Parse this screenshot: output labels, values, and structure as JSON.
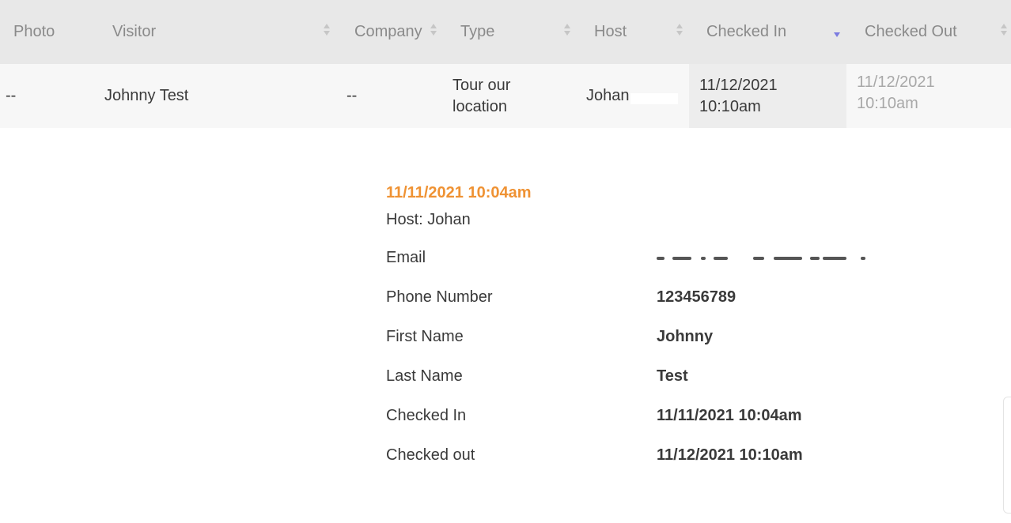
{
  "table": {
    "columns": [
      {
        "label": "Photo"
      },
      {
        "label": "Visitor"
      },
      {
        "label": "Company"
      },
      {
        "label": "Type"
      },
      {
        "label": "Host"
      },
      {
        "label": "Checked In"
      },
      {
        "label": "Checked Out"
      }
    ],
    "row": {
      "photo": "--",
      "visitor": "Johnny Test",
      "company": "--",
      "type_line1": "Tour our",
      "type_line2": "location",
      "host": "Johan",
      "checked_in_date": "11/12/2021",
      "checked_in_time": "10:10am",
      "checked_out_date": "11/12/2021",
      "checked_out_time": "10:10am"
    }
  },
  "detail": {
    "date": "11/11/2021 10:04am",
    "host": "Host: Johan",
    "fields": [
      {
        "label": "Email",
        "value": ""
      },
      {
        "label": "Phone Number",
        "value": "123456789"
      },
      {
        "label": "First Name",
        "value": "Johnny"
      },
      {
        "label": "Last Name",
        "value": "Test"
      },
      {
        "label": "Checked In",
        "value": "11/11/2021 10:04am"
      },
      {
        "label": "Checked out",
        "value": "11/12/2021 10:10am"
      }
    ]
  },
  "colors": {
    "accent_date": "#ef9233",
    "sort_active": "#7b7be0",
    "header_bg": "#e8e8e8",
    "row_bg": "#f7f7f7"
  }
}
